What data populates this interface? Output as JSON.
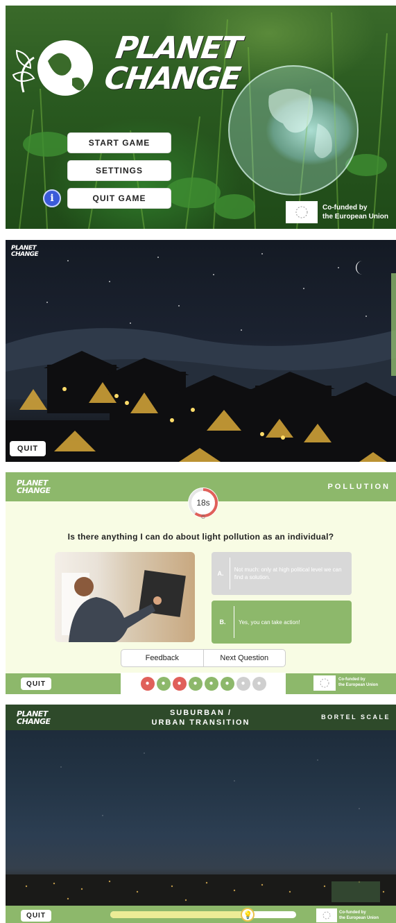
{
  "menu": {
    "logo_line1": "PLANET",
    "logo_line2": "CHANGE",
    "start_label": "START GAME",
    "settings_label": "SETTINGS",
    "quit_label": "QUIT GAME",
    "info_glyph": "i",
    "eu_line1": "Co-funded by",
    "eu_line2": "the European Union"
  },
  "night": {
    "logo_line1": "PLANET",
    "logo_line2": "CHANGE",
    "quit_label": "QUIT"
  },
  "quiz": {
    "logo_line1": "PLANET",
    "logo_line2": "CHANGE",
    "category": "POLLUTION",
    "timer": "18s",
    "timer_fraction_remaining": 0.6,
    "question": "Is there anything I can do about light pollution as an individual?",
    "answers": [
      {
        "letter": "A.",
        "text": "Not much: only at high political level we can find a solution.",
        "state": "unselected"
      },
      {
        "letter": "B.",
        "text": "Yes, you can take action!",
        "state": "selected"
      }
    ],
    "feedback_label": "Feedback",
    "next_label": "Next Question",
    "quit_label": "QUIT",
    "progress": [
      "wrong",
      "correct",
      "wrong",
      "correct",
      "correct",
      "correct",
      "pending",
      "pending"
    ],
    "eu_line1": "Co-funded by",
    "eu_line2": "the European Union"
  },
  "bortle": {
    "logo_line1": "PLANET",
    "logo_line2": "CHANGE",
    "location_line1": "SUBURBAN /",
    "location_line2": "URBAN TRANSITION",
    "scale_label": "BORTEL SCALE",
    "quit_label": "QUIT",
    "slider_fraction": 0.74,
    "eu_line1": "Co-funded by",
    "eu_line2": "the European Union"
  },
  "colors": {
    "accent_green": "#8db86b",
    "dark_green": "#2e4a2a",
    "wrong_red": "#e0605a",
    "correct_green": "#8db86b",
    "pending_grey": "#cfcfcf",
    "info_blue": "#3b5bd9"
  }
}
